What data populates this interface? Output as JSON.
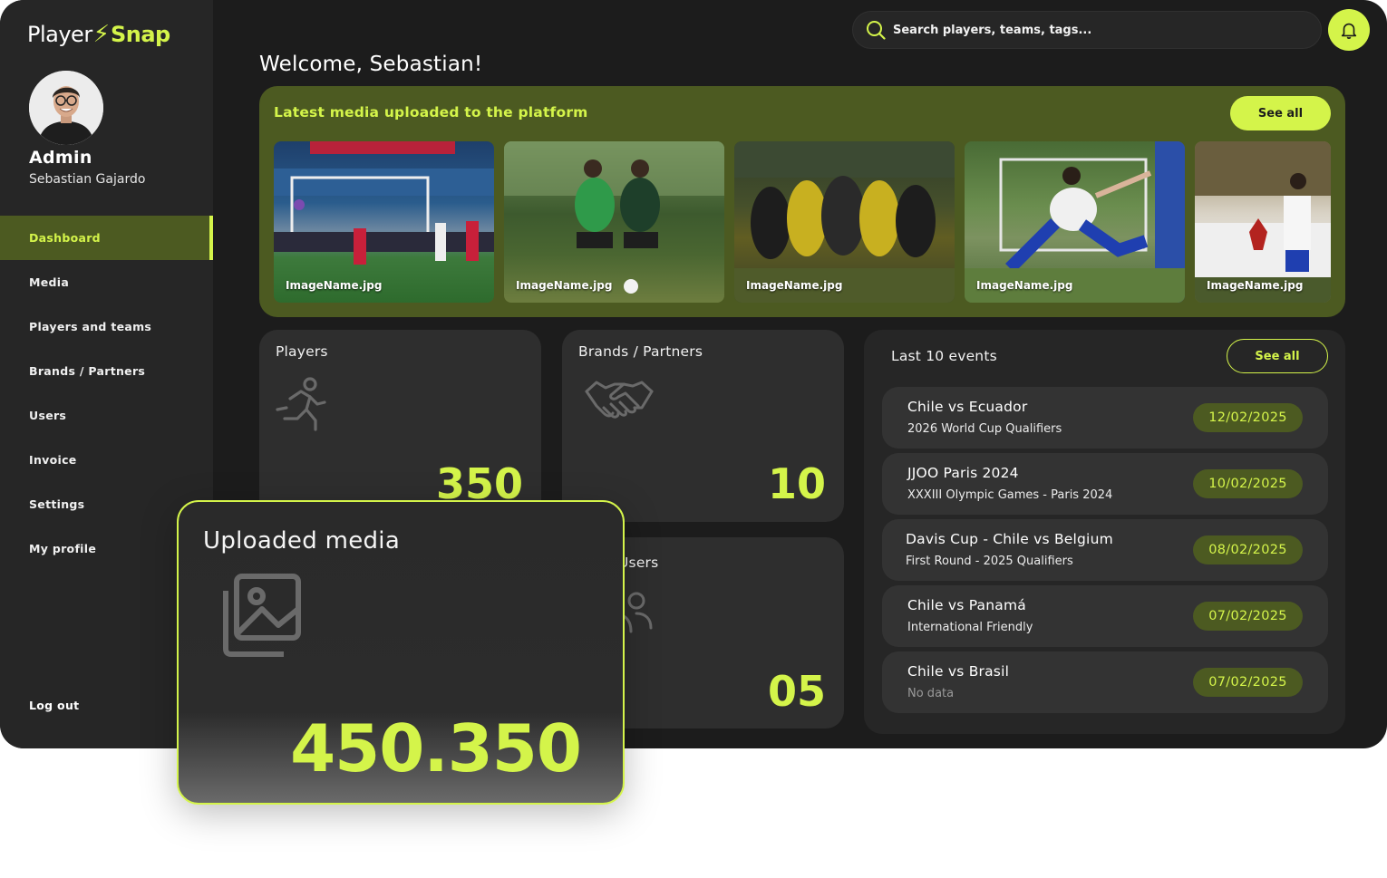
{
  "brand": {
    "name_part1": "Player",
    "name_part2": "Snap",
    "accent": "#d4f44a",
    "accent_dark": "#4c5a21"
  },
  "user": {
    "role": "Admin",
    "name": "Sebastian Gajardo"
  },
  "sidebar": {
    "items": [
      {
        "label": "Dashboard",
        "active": true
      },
      {
        "label": "Media"
      },
      {
        "label": "Players and teams"
      },
      {
        "label": "Brands / Partners"
      },
      {
        "label": "Users"
      },
      {
        "label": "Invoice"
      },
      {
        "label": "Settings"
      },
      {
        "label": "My profile"
      }
    ],
    "logout": "Log out"
  },
  "header": {
    "search_placeholder": "Search players, teams, tags...",
    "welcome": "Welcome, Sebastian!"
  },
  "media": {
    "title": "Latest media uploaded to the platform",
    "see_all": "See all",
    "items": [
      {
        "caption": "ImageName.jpg"
      },
      {
        "caption": "ImageName.jpg"
      },
      {
        "caption": "ImageName.jpg"
      },
      {
        "caption": "ImageName.jpg"
      },
      {
        "caption": "ImageName.jpg"
      }
    ]
  },
  "stats": {
    "players": {
      "label": "Players",
      "value": "350",
      "icon": "running-person-icon"
    },
    "brands": {
      "label": "Brands / Partners",
      "value": "10",
      "icon": "handshake-icon"
    },
    "users": {
      "label": "Users",
      "value": "05",
      "icon": "users-icon"
    },
    "uploaded": {
      "label": "Uploaded media",
      "value": "450.350",
      "icon": "image-gallery-icon"
    }
  },
  "events": {
    "title": "Last 10 events",
    "see_all": "See all",
    "items": [
      {
        "title": "Chile vs Ecuador",
        "subtitle": "2026 World Cup Qualifiers",
        "date": "12/02/2025"
      },
      {
        "title": "JJOO Paris 2024",
        "subtitle": "XXXIII Olympic Games - Paris 2024",
        "date": "10/02/2025"
      },
      {
        "title": "Davis Cup - Chile vs Belgium",
        "subtitle": "First Round - 2025 Qualifiers",
        "date": "08/02/2025"
      },
      {
        "title": "Chile vs Panamá",
        "subtitle": "International Friendly",
        "date": "07/02/2025"
      },
      {
        "title": "Chile vs Brasil",
        "subtitle": "No data",
        "date": "07/02/2025"
      }
    ]
  }
}
